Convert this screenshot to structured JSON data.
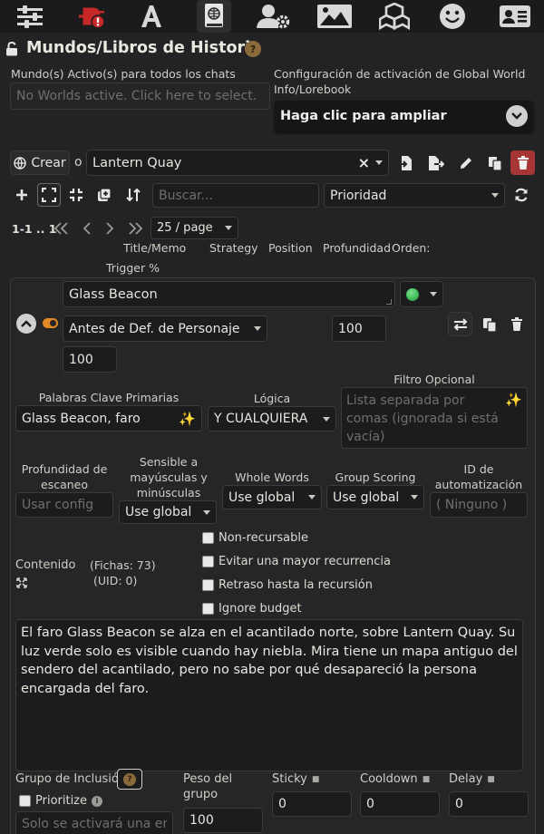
{
  "title": "Mundos/Libros de Historia",
  "active_worlds": {
    "label": "Mundo(s) Activo(s) para todos los chats",
    "placeholder": "No Worlds active. Click here to select."
  },
  "activation_settings": {
    "label": "Configuración de activación de Global World Info/Lorebook",
    "expand_label": "Haga clic para ampliar"
  },
  "toolbar": {
    "create_label": "Crear",
    "or_label": "o",
    "selected_world": "Lantern Quay"
  },
  "search": {
    "placeholder": "Buscar...",
    "sort_value": "Prioridad"
  },
  "pagination": {
    "range": "1-1 .. 1",
    "page_size": "25 / page"
  },
  "columns": {
    "title_memo": "Title/Memo",
    "strategy": "Strategy",
    "position": "Position",
    "depth": "Profundidad",
    "order": "Orden:",
    "trigger": "Trigger %"
  },
  "entry": {
    "title": "Glass Beacon",
    "position": "Antes de Def. de Personaje",
    "depth": "100",
    "order": "100",
    "primary_keys_label": "Palabras Clave Primarias",
    "primary_keys_value": "Glass Beacon, faro",
    "logic_label": "Lógica",
    "logic_value": "Y CUALQUIERA",
    "optional_filter_label": "Filtro Opcional",
    "optional_filter_placeholder": "Lista separada por comas (ignorada si está vacía)",
    "scan_depth_label": "Profundidad de escaneo",
    "scan_depth_placeholder": "Usar config",
    "case_sensitive_label": "Sensible a mayúsculas y minúsculas",
    "case_sensitive_value": "Use global",
    "whole_words_label": "Whole Words",
    "whole_words_value": "Use global",
    "group_scoring_label": "Group Scoring",
    "group_scoring_value": "Use global",
    "automation_id_label": "ID de automatización",
    "automation_id_placeholder": "( Ninguno )",
    "content_label": "Contenido",
    "tokens_label": "(Fichas:",
    "tokens_value": "73)",
    "uid_label": "(UID:",
    "uid_value": "0)",
    "checks": {
      "non_recursable": "Non-recursable",
      "prevent_recursion": "Evitar una mayor recurrencia",
      "delay_recursion": "Retraso hasta la recursión",
      "ignore_budget": "Ignore budget"
    },
    "content": "El faro Glass Beacon se alza en el acantilado norte, sobre Lantern Quay. Su luz verde solo es visible cuando hay niebla. Mira tiene un mapa antiguo del sendero del acantilado, pero no sabe por qué desapareció la persona encargada del faro.",
    "inclusion_group_label": "Grupo de Inclusión",
    "inclusion_group_placeholder": "Solo se activará una en",
    "prioritize_label": "Prioritize",
    "group_weight_label": "Peso del grupo",
    "group_weight_value": "100",
    "sticky_label": "Sticky",
    "sticky_value": "0",
    "cooldown_label": "Cooldown",
    "cooldown_value": "0",
    "delay_label": "Delay",
    "delay_value": "0",
    "help_glyph": "?",
    "info_glyph": "i"
  },
  "colors": {
    "accent": "#e18a24",
    "status_green": "#3fbf5a",
    "delete_red": "#a63636",
    "background": "#232325"
  }
}
